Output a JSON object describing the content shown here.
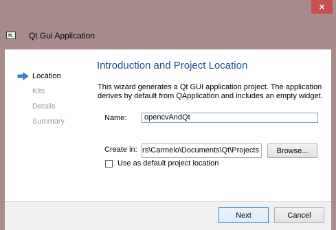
{
  "window": {
    "title": "Qt Gui Application",
    "close_glyph": "×"
  },
  "sidebar": {
    "items": [
      {
        "label": "Location",
        "active": true
      },
      {
        "label": "Kits",
        "active": false
      },
      {
        "label": "Details",
        "active": false
      },
      {
        "label": "Summary",
        "active": false
      }
    ],
    "active_icon": "arrow-right-icon"
  },
  "page": {
    "heading": "Introduction and Project Location",
    "description": "This wizard generates a Qt GUI application project. The application derives by default from QApplication and includes an empty widget."
  },
  "form": {
    "name_label": "Name:",
    "name_value": "opencvAndQt",
    "create_in_label": "Create in:",
    "create_in_value": "C:\\Users\\Carmelo\\Documents\\Qt\\Projects",
    "browse_label": "Browse...",
    "default_location_label": "Use as default project location",
    "default_location_checked": false
  },
  "footer": {
    "next_label": "Next",
    "cancel_label": "Cancel"
  },
  "colors": {
    "accent_heading": "#1f4e8c",
    "arrow": "#3d7fd6",
    "close_button": "#c7504f"
  }
}
